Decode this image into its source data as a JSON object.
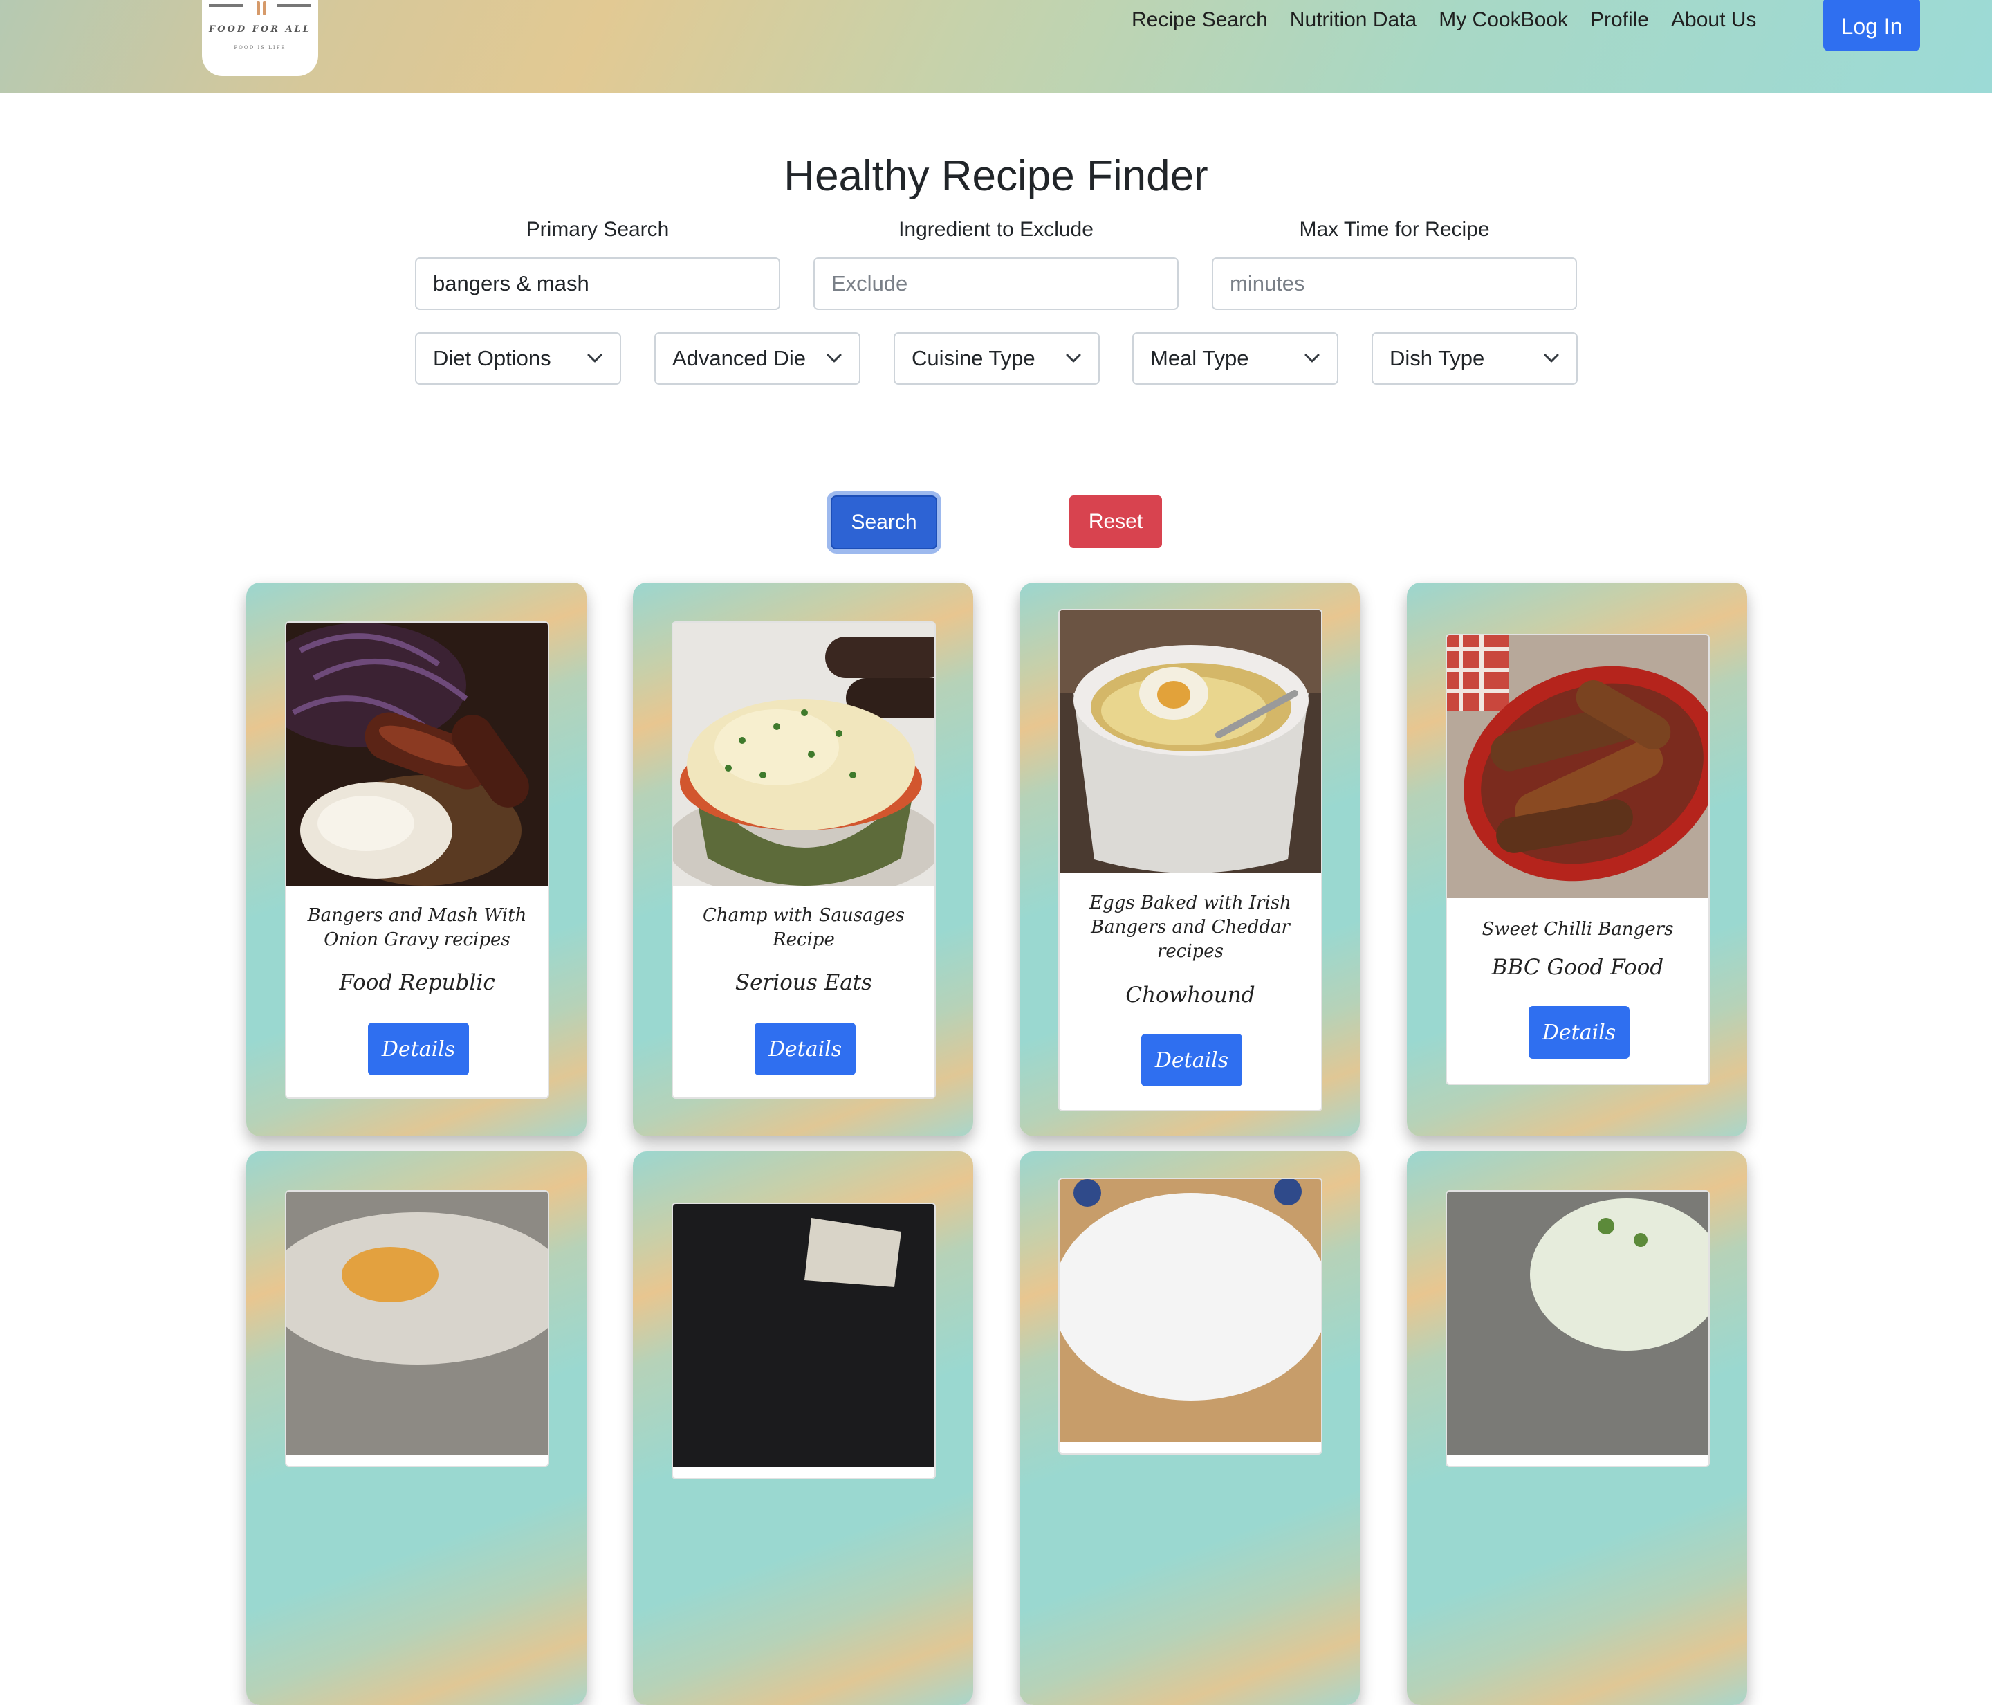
{
  "logo": {
    "title": "FOOD FOR ALL",
    "subtitle": "FOOD IS LIFE"
  },
  "nav": {
    "links": [
      "Recipe Search",
      "Nutrition Data",
      "My CookBook",
      "Profile",
      "About Us"
    ],
    "login_label": "Log In"
  },
  "page_title": "Healthy Recipe Finder",
  "fields": {
    "primary": {
      "label": "Primary Search",
      "value": "bangers & mash",
      "placeholder": ""
    },
    "exclude": {
      "label": "Ingredient to Exclude",
      "value": "",
      "placeholder": "Exclude"
    },
    "max_time": {
      "label": "Max Time for Recipe",
      "value": "",
      "placeholder": "minutes"
    }
  },
  "filters": [
    "Diet Options",
    "Advanced Die",
    "Cuisine Type",
    "Meal Type",
    "Dish Type"
  ],
  "buttons": {
    "search": "Search",
    "reset": "Reset"
  },
  "recipes": [
    {
      "title": "Bangers and Mash With Onion Gravy recipes",
      "source": "Food Republic",
      "details": "Details",
      "image": "sausages-mash-onion-gravy"
    },
    {
      "title": "Champ with Sausages Recipe",
      "source": "Serious Eats",
      "details": "Details",
      "image": "mashed-potato-bowl-sausages"
    },
    {
      "title": "Eggs Baked with Irish Bangers and Cheddar recipes",
      "source": "Chowhound",
      "details": "Details",
      "image": "baked-egg-ramekin"
    },
    {
      "title": "Sweet Chilli Bangers",
      "source": "BBC Good Food",
      "details": "Details",
      "image": "roasted-sausages-dish"
    }
  ],
  "colors": {
    "primary_blue": "#2f6ff0",
    "search_blue": "#2d63d4",
    "reset_red": "#d8434f",
    "card_teal": "#9ad8d0",
    "card_sand": "#e8c690"
  }
}
